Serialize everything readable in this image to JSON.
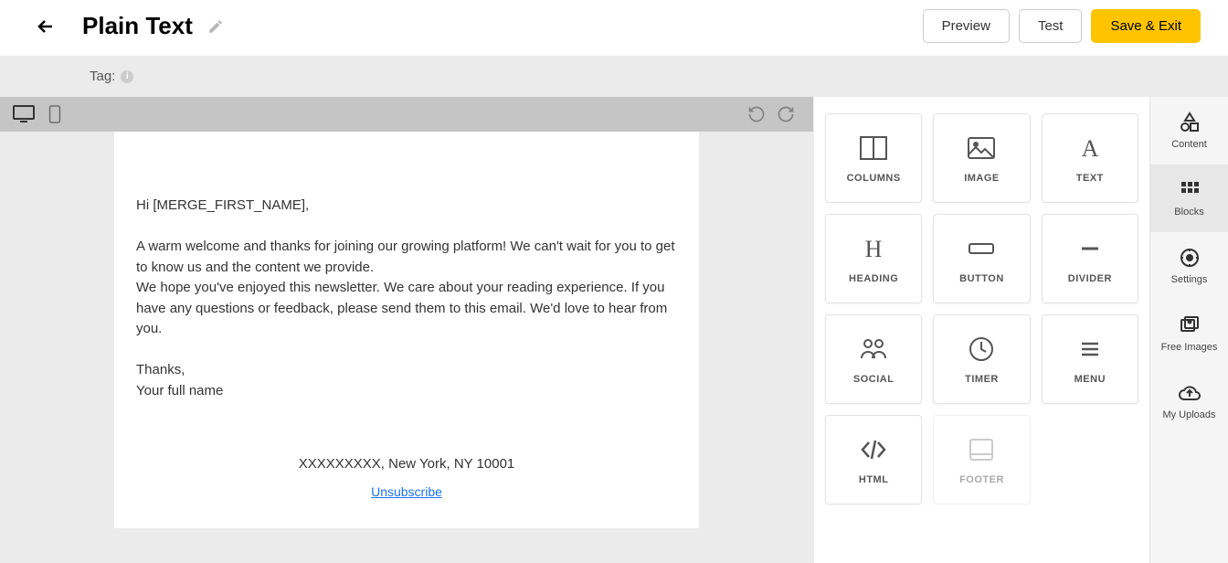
{
  "header": {
    "title": "Plain Text",
    "preview": "Preview",
    "test": "Test",
    "save": "Save & Exit"
  },
  "tagbar": {
    "label": "Tag:"
  },
  "email": {
    "greeting": "Hi [MERGE_FIRST_NAME],",
    "p1": "A warm welcome and thanks for joining our growing platform! We can't wait for you to get to know us and the content we provide.",
    "p2": "We hope you've enjoyed this newsletter. We care about your reading experience. If you have any questions or feedback, please send them to this email. We'd love to hear from you.",
    "thanks": "Thanks,",
    "signature": "Your full name",
    "address": "XXXXXXXXX, New York, NY 10001",
    "unsubscribe": "Unsubscribe"
  },
  "blocks": {
    "columns": "COLUMNS",
    "image": "IMAGE",
    "text": "TEXT",
    "heading": "HEADING",
    "button": "BUTTON",
    "divider": "DIVIDER",
    "social": "SOCIAL",
    "timer": "TIMER",
    "menu": "MENU",
    "html": "HTML",
    "footer": "FOOTER"
  },
  "rail": {
    "content": "Content",
    "blocks": "Blocks",
    "settings": "Settings",
    "freeimages": "Free Images",
    "uploads": "My Uploads"
  }
}
